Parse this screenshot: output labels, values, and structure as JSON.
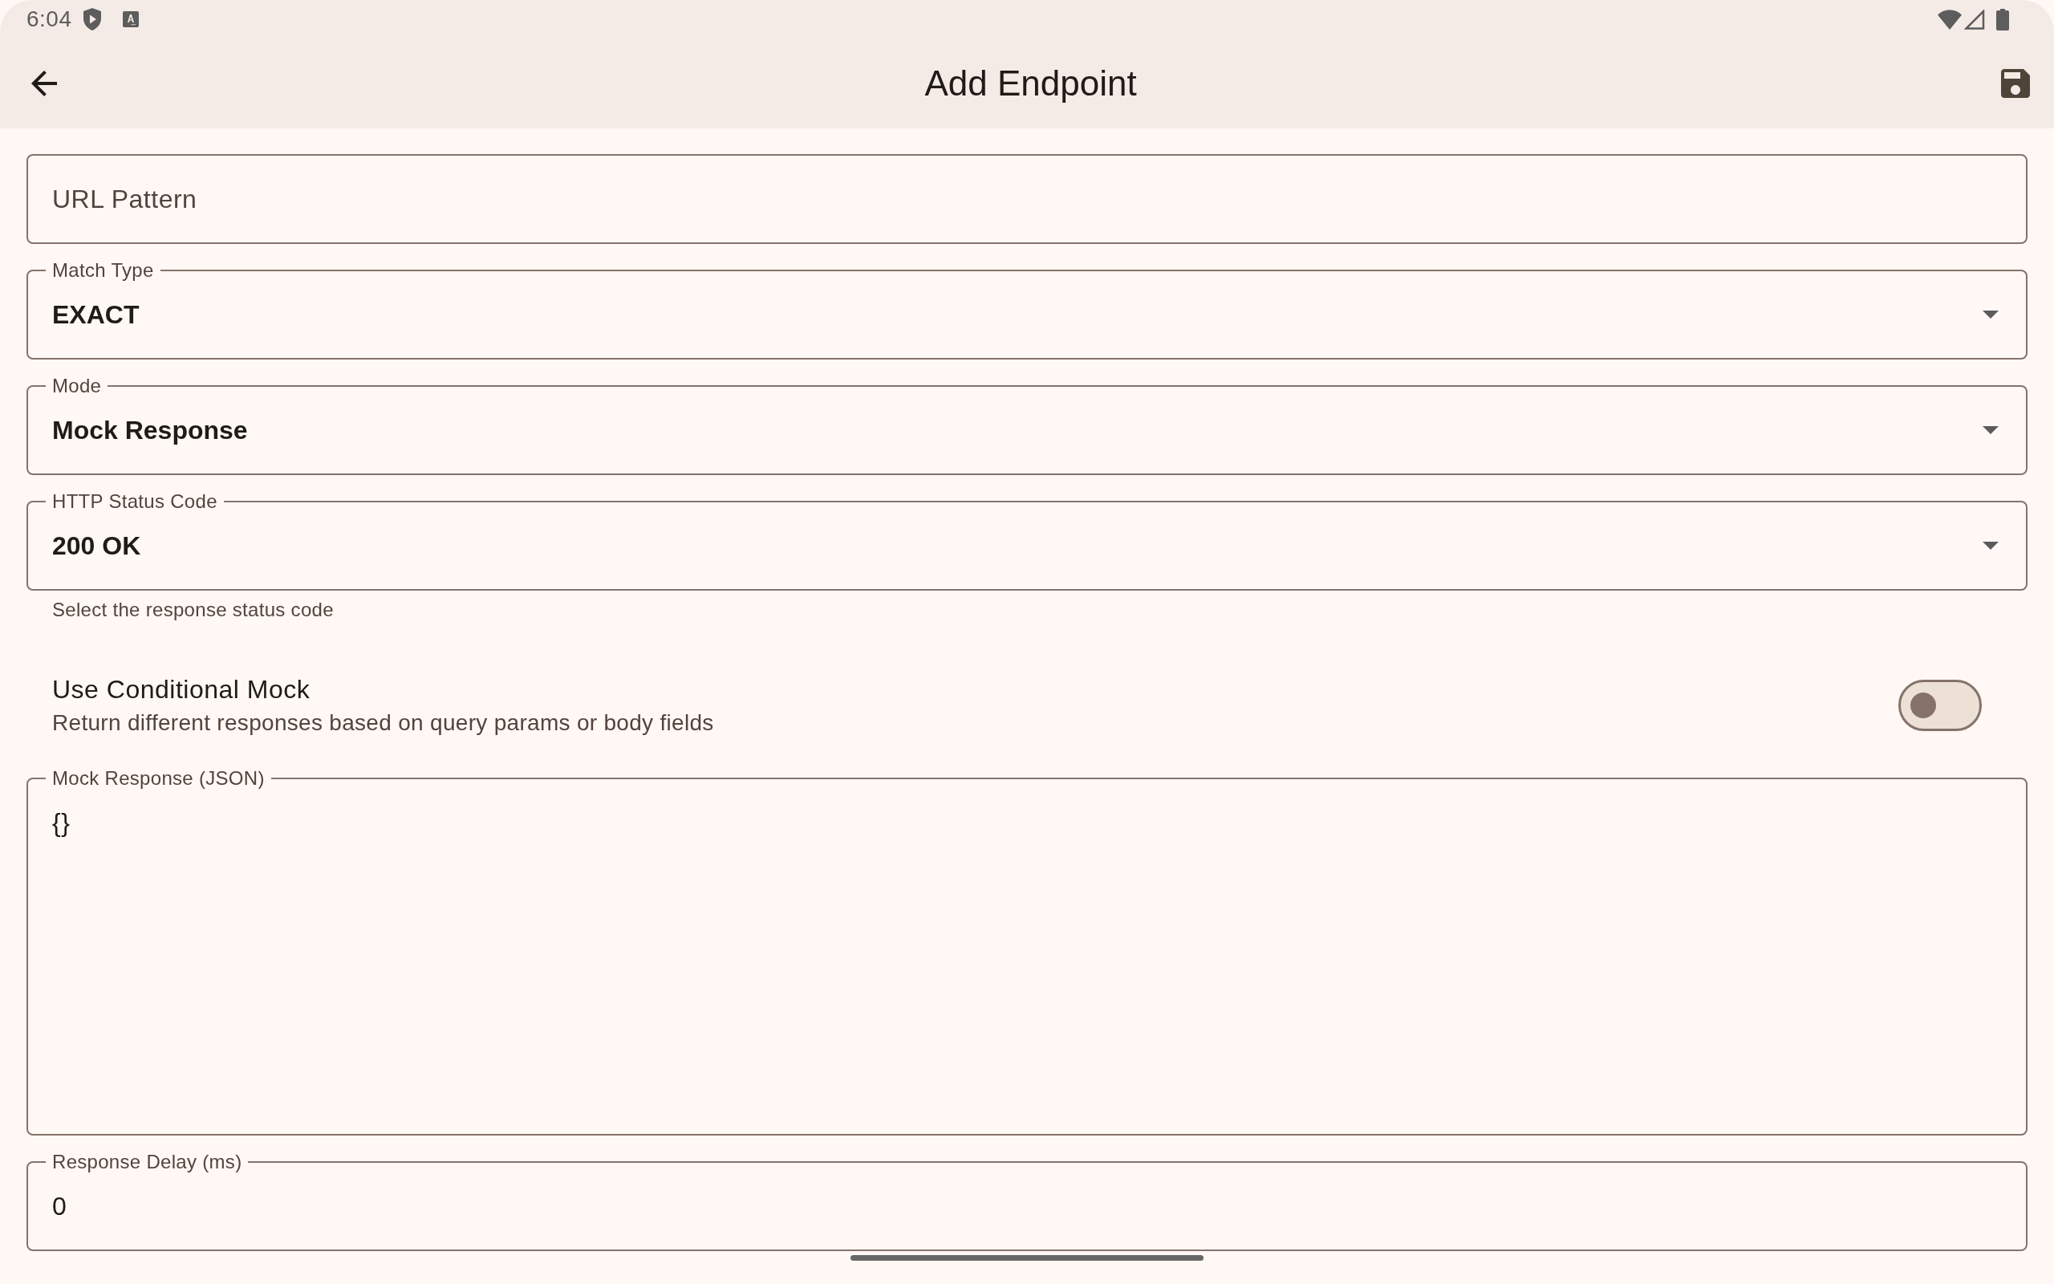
{
  "status_bar": {
    "time": "6:04"
  },
  "app_bar": {
    "title": "Add Endpoint"
  },
  "form": {
    "fields": [
      {
        "kind": "text",
        "placeholder": "URL Pattern"
      },
      {
        "kind": "dropdown",
        "label": "Match Type",
        "value": "EXACT"
      },
      {
        "kind": "dropdown",
        "label": "Mode",
        "value": "Mock Response"
      },
      {
        "kind": "dropdown",
        "label": "HTTP Status Code",
        "value": "200 OK",
        "helper": "Select the response status code"
      },
      {
        "kind": "switch",
        "title": "Use Conditional Mock",
        "subtitle": "Return different responses based on query params or body fields",
        "on": false
      },
      {
        "kind": "textarea",
        "label": "Mock Response (JSON)",
        "value": "{}"
      },
      {
        "kind": "text",
        "label": "Response Delay (ms)",
        "value": "0"
      }
    ]
  }
}
